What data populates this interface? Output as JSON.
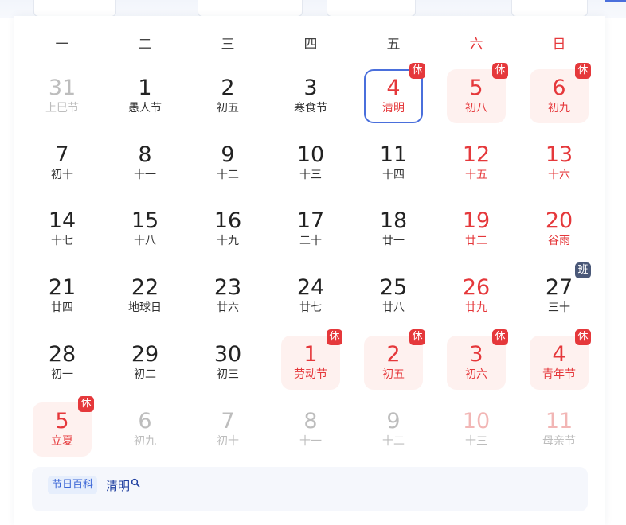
{
  "weekdays": [
    "一",
    "二",
    "三",
    "四",
    "五",
    "六",
    "日"
  ],
  "colors": {
    "holiday_red": "#e5383b",
    "today_border": "#4a6fdc",
    "holiday_bg": "#fef1ef",
    "work_badge": "#4a5878",
    "muted": "#bdbdbd"
  },
  "badges": {
    "rest": "休",
    "work": "班"
  },
  "weeks": [
    [
      {
        "day": "31",
        "lunar": "上巳节",
        "state": "muted"
      },
      {
        "day": "1",
        "lunar": "愚人节",
        "state": "normal"
      },
      {
        "day": "2",
        "lunar": "初五",
        "state": "normal"
      },
      {
        "day": "3",
        "lunar": "寒食节",
        "state": "normal"
      },
      {
        "day": "4",
        "lunar": "清明",
        "state": "today",
        "badge": "休"
      },
      {
        "day": "5",
        "lunar": "初八",
        "state": "holiday",
        "badge": "休"
      },
      {
        "day": "6",
        "lunar": "初九",
        "state": "holiday",
        "badge": "休"
      }
    ],
    [
      {
        "day": "7",
        "lunar": "初十",
        "state": "normal"
      },
      {
        "day": "8",
        "lunar": "十一",
        "state": "normal"
      },
      {
        "day": "9",
        "lunar": "十二",
        "state": "normal"
      },
      {
        "day": "10",
        "lunar": "十三",
        "state": "normal"
      },
      {
        "day": "11",
        "lunar": "十四",
        "state": "normal"
      },
      {
        "day": "12",
        "lunar": "十五",
        "state": "weekend"
      },
      {
        "day": "13",
        "lunar": "十六",
        "state": "weekend"
      }
    ],
    [
      {
        "day": "14",
        "lunar": "十七",
        "state": "normal"
      },
      {
        "day": "15",
        "lunar": "十八",
        "state": "normal"
      },
      {
        "day": "16",
        "lunar": "十九",
        "state": "normal"
      },
      {
        "day": "17",
        "lunar": "二十",
        "state": "normal"
      },
      {
        "day": "18",
        "lunar": "廿一",
        "state": "normal"
      },
      {
        "day": "19",
        "lunar": "廿二",
        "state": "weekend"
      },
      {
        "day": "20",
        "lunar": "谷雨",
        "state": "weekend"
      }
    ],
    [
      {
        "day": "21",
        "lunar": "廿四",
        "state": "normal"
      },
      {
        "day": "22",
        "lunar": "地球日",
        "state": "normal"
      },
      {
        "day": "23",
        "lunar": "廿六",
        "state": "normal"
      },
      {
        "day": "24",
        "lunar": "廿七",
        "state": "normal"
      },
      {
        "day": "25",
        "lunar": "廿八",
        "state": "normal"
      },
      {
        "day": "26",
        "lunar": "廿九",
        "state": "weekend"
      },
      {
        "day": "27",
        "lunar": "三十",
        "state": "normal",
        "badge": "班"
      }
    ],
    [
      {
        "day": "28",
        "lunar": "初一",
        "state": "normal"
      },
      {
        "day": "29",
        "lunar": "初二",
        "state": "normal"
      },
      {
        "day": "30",
        "lunar": "初三",
        "state": "normal"
      },
      {
        "day": "1",
        "lunar": "劳动节",
        "state": "holiday",
        "badge": "休"
      },
      {
        "day": "2",
        "lunar": "初五",
        "state": "holiday",
        "badge": "休"
      },
      {
        "day": "3",
        "lunar": "初六",
        "state": "holiday",
        "badge": "休"
      },
      {
        "day": "4",
        "lunar": "青年节",
        "state": "holiday",
        "badge": "休"
      }
    ],
    [
      {
        "day": "5",
        "lunar": "立夏",
        "state": "holiday",
        "badge": "休"
      },
      {
        "day": "6",
        "lunar": "初九",
        "state": "muted"
      },
      {
        "day": "7",
        "lunar": "初十",
        "state": "muted"
      },
      {
        "day": "8",
        "lunar": "十一",
        "state": "muted"
      },
      {
        "day": "9",
        "lunar": "十二",
        "state": "muted"
      },
      {
        "day": "10",
        "lunar": "十三",
        "state": "muted-red"
      },
      {
        "day": "11",
        "lunar": "母亲节",
        "state": "muted-red"
      }
    ]
  ],
  "festival_bar": {
    "tag": "节日百科",
    "festival": "清明",
    "icon": "search-icon"
  }
}
